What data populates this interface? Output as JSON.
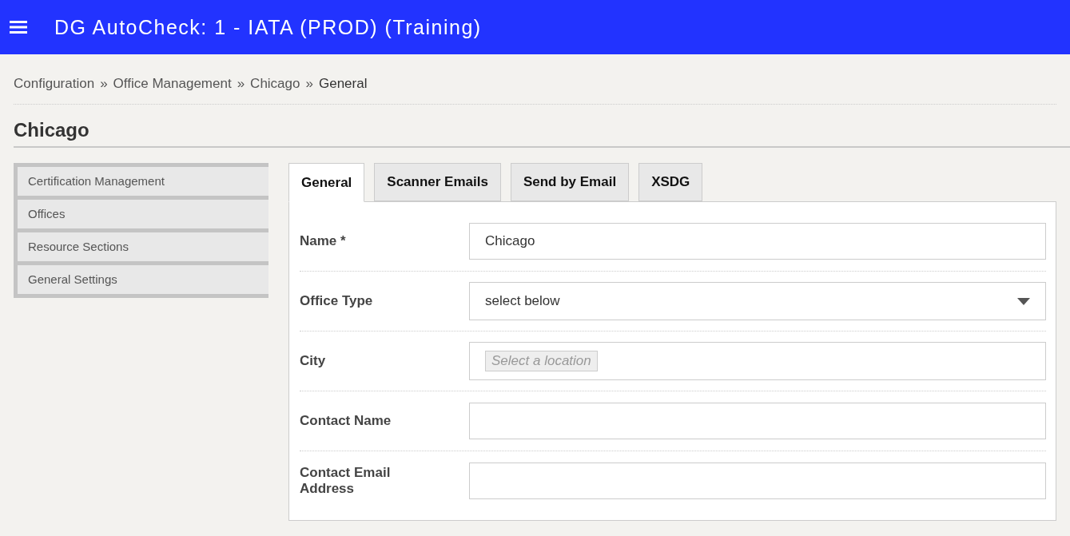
{
  "header": {
    "title": "DG AutoCheck: 1 - IATA (PROD) (Training)"
  },
  "breadcrumb": [
    {
      "kind": "link",
      "text": "Configuration"
    },
    {
      "kind": "separator",
      "text": "»"
    },
    {
      "kind": "link",
      "text": "Office Management"
    },
    {
      "kind": "separator",
      "text": "»"
    },
    {
      "kind": "link",
      "text": "Chicago"
    },
    {
      "kind": "separator",
      "text": "»"
    },
    {
      "kind": "current",
      "text": "General"
    }
  ],
  "page_title": "Chicago",
  "sidebar": {
    "items": [
      {
        "label": "Certification Management"
      },
      {
        "label": "Offices"
      },
      {
        "label": "Resource Sections"
      },
      {
        "label": "General Settings"
      }
    ]
  },
  "tabs": [
    {
      "label": "General",
      "selected": true
    },
    {
      "label": "Scanner Emails",
      "selected": false
    },
    {
      "label": "Send by Email",
      "selected": false
    },
    {
      "label": "XSDG",
      "selected": false
    }
  ],
  "form": {
    "fields": [
      {
        "kind": "text",
        "label": "Name *",
        "value": "Chicago"
      },
      {
        "kind": "select",
        "label": "Office Type",
        "value": "select below"
      },
      {
        "kind": "location",
        "label": "City",
        "placeholder": "Select a location"
      },
      {
        "kind": "text",
        "label": "Contact Name"
      },
      {
        "kind": "text",
        "label": "Contact Email Address"
      }
    ]
  }
}
